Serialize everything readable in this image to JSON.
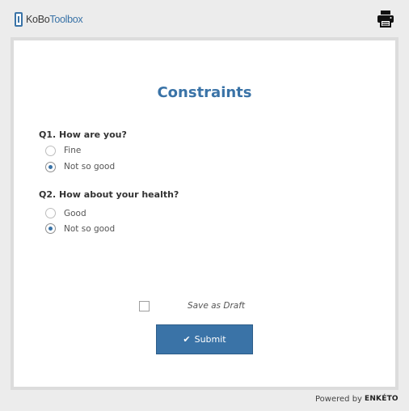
{
  "header": {
    "logo": {
      "part1": "KoBo",
      "part2": "Toolbox"
    },
    "print_icon": "print-icon"
  },
  "form": {
    "title": "Constraints",
    "questions": [
      {
        "label": "Q1. How are you?",
        "options": [
          {
            "label": "Fine",
            "checked": false
          },
          {
            "label": "Not so good",
            "checked": true
          }
        ]
      },
      {
        "label": "Q2. How about your health?",
        "options": [
          {
            "label": "Good",
            "checked": false
          },
          {
            "label": "Not so good",
            "checked": true
          }
        ]
      }
    ],
    "save_draft_label": "Save as Draft",
    "save_draft_checked": false,
    "submit_label": "Submit",
    "submit_icon": "checkmark-icon"
  },
  "footer": {
    "powered_by": "Powered by",
    "brand": "ENKÉTO"
  },
  "colors": {
    "accent": "#3a73a7",
    "background": "#ececec",
    "card_border": "#dcdcdc"
  }
}
